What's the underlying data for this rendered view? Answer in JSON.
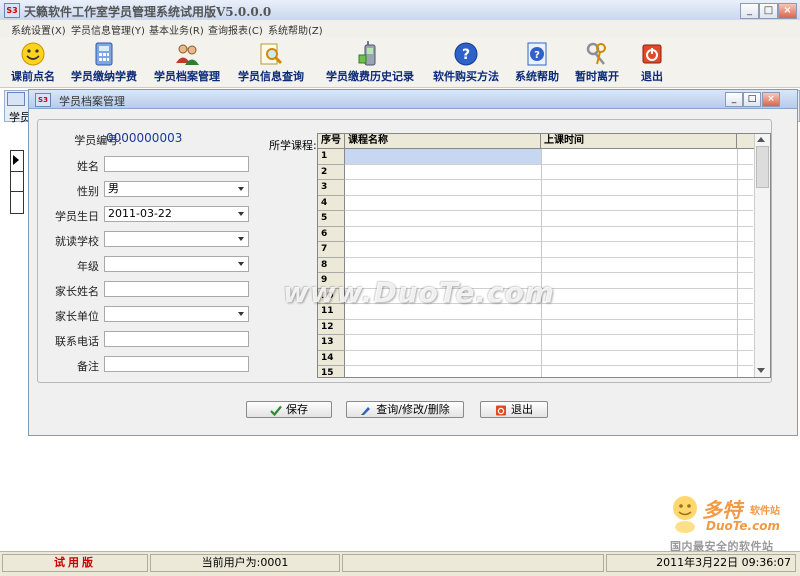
{
  "app": {
    "title": "天籁软件工作室学员管理系统试用版V5.0.0.0",
    "icon_text": "S3"
  },
  "menu": [
    "系统设置(X)",
    "学员信息管理(Y)",
    "基本业务(R)",
    "查询报表(C)",
    "系统帮助(Z)"
  ],
  "toolbar": [
    {
      "label": "课前点名",
      "icon": "smiley-icon"
    },
    {
      "label": "学员缴纳学费",
      "icon": "calculator-icon"
    },
    {
      "label": "学员档案管理",
      "icon": "users-icon"
    },
    {
      "label": "学员信息查询",
      "icon": "search-doc-icon"
    },
    {
      "label": "学员缴费历史记录",
      "icon": "phone-icon"
    },
    {
      "label": "软件购买方法",
      "icon": "help-icon"
    },
    {
      "label": "系统帮助",
      "icon": "help-doc-icon"
    },
    {
      "label": "暂时离开",
      "icon": "keys-icon"
    },
    {
      "label": "退出",
      "icon": "exit-icon"
    }
  ],
  "background_window": {
    "tab_fragment": "学员"
  },
  "dialog": {
    "title": "学员档案管理",
    "fields": {
      "student_id_label": "学员编号:",
      "student_id_value": "0000000003",
      "name_label": "姓名",
      "name_value": "",
      "gender_label": "性别",
      "gender_value": "男",
      "birthday_label": "学员生日",
      "birthday_value": "2011-03-22",
      "school_label": "就读学校",
      "school_value": "",
      "grade_label": "年级",
      "grade_value": "",
      "parent_name_label": "家长姓名",
      "parent_name_value": "",
      "parent_work_label": "家长单位",
      "parent_work_value": "",
      "phone_label": "联系电话",
      "phone_value": "",
      "note_label": "备注",
      "note_value": ""
    },
    "courses_label": "所学课程:",
    "grid": {
      "columns": [
        "序号",
        "课程名称",
        "上课时间"
      ],
      "rows": [
        "1",
        "2",
        "3",
        "4",
        "5",
        "6",
        "7",
        "8",
        "9",
        "10",
        "11",
        "12",
        "13",
        "14",
        "15"
      ]
    },
    "buttons": {
      "save": "保存",
      "query": "查询/修改/删除",
      "exit": "退出"
    }
  },
  "status": {
    "trial": "试用版",
    "user": "当前用户为:0001",
    "datetime": "2011年3月22日  09:36:07"
  },
  "watermark": {
    "text": "www.DuoTe.com",
    "logo_cn": "多特",
    "logo_sub": "软件站",
    "logo_url": "DuoTe.com",
    "logo_slogan": "国内最安全的软件站"
  },
  "colors": {
    "toolbar_label": "#0b2a7a",
    "student_id": "#1a3a9a",
    "trial": "#cc0000",
    "selected_cell": "#c8d7f0"
  }
}
